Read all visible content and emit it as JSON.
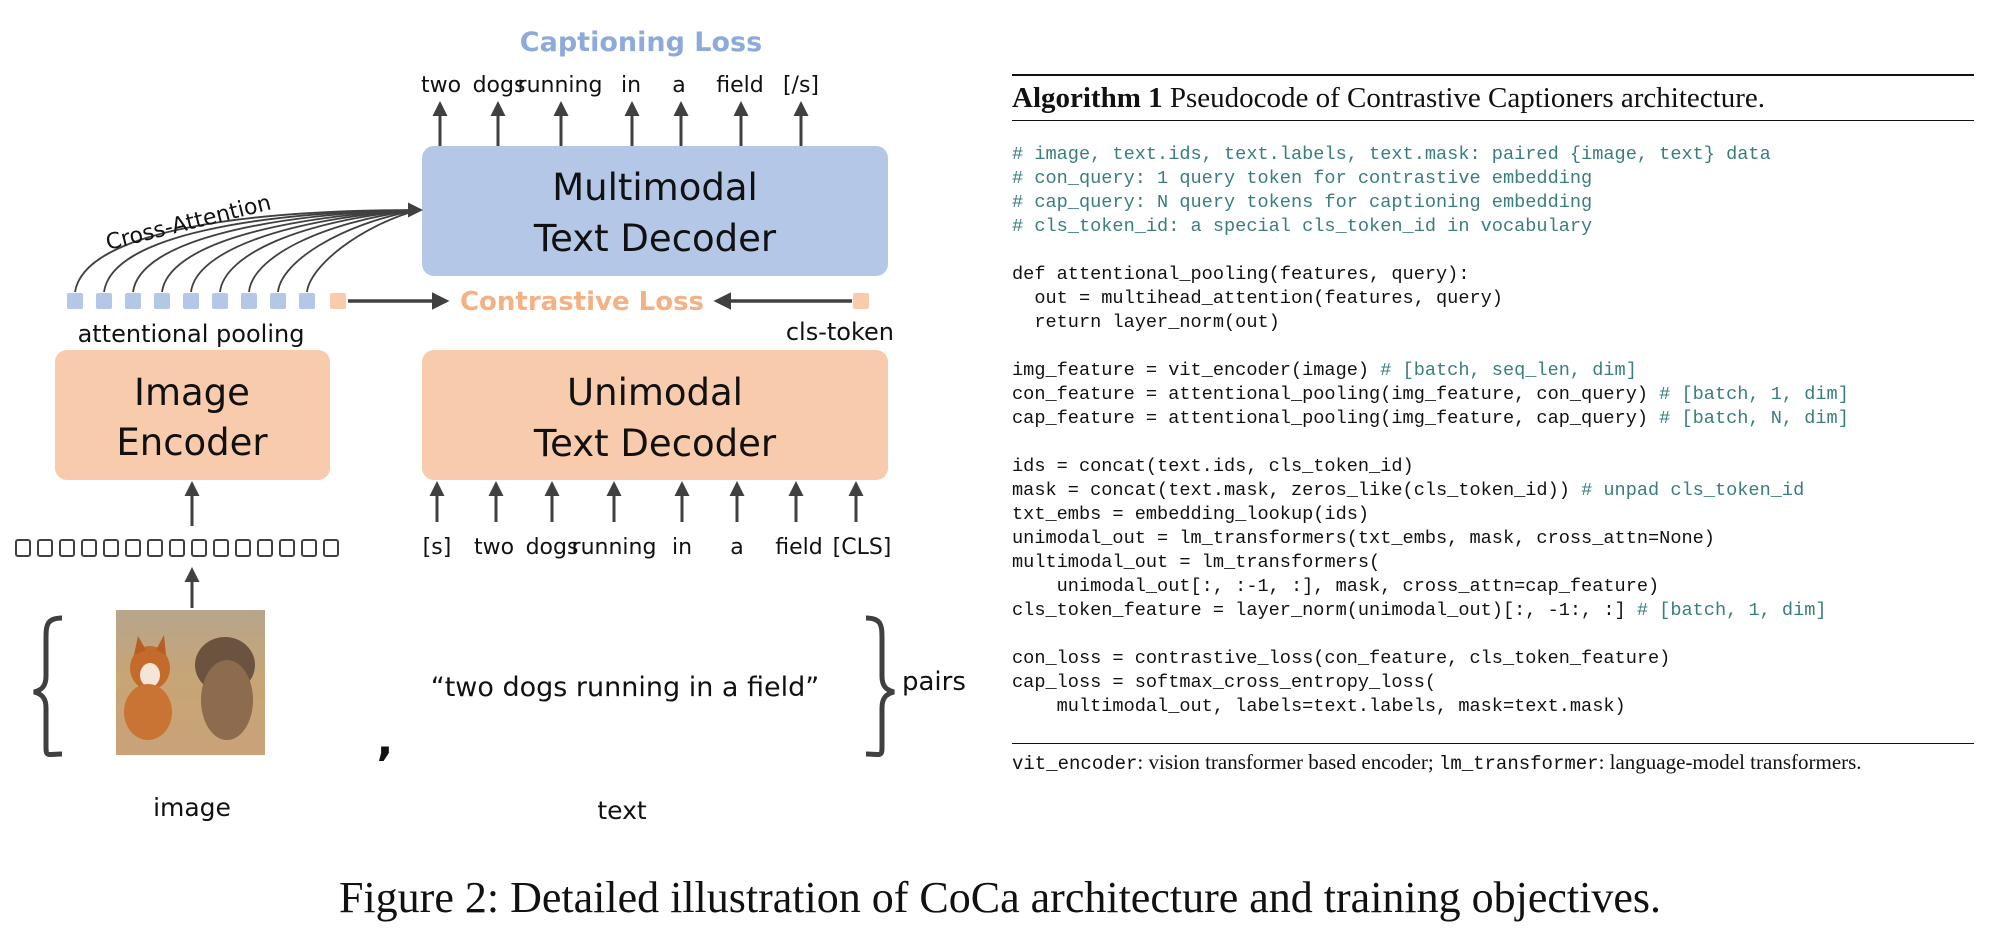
{
  "diagram": {
    "captioning_loss": "Captioning Loss",
    "output_tokens": [
      "two",
      "dogs",
      "running",
      "in",
      "a",
      "field",
      "[/s]"
    ],
    "multimodal_decoder": [
      "Multimodal",
      "Text Decoder"
    ],
    "cross_attention": "Cross-Attention",
    "contrastive_loss": "Contrastive Loss",
    "attentional_pooling": "attentional pooling",
    "cls_token": "cls-token",
    "image_encoder": [
      "Image",
      "Encoder"
    ],
    "unimodal_decoder": [
      "Unimodal",
      "Text Decoder"
    ],
    "input_tokens": [
      "[s]",
      "two",
      "dogs",
      "running",
      "in",
      "a",
      "field",
      "[CLS]"
    ],
    "text_pair": "“two dogs running in a field”",
    "comma": ",",
    "pairs": "pairs",
    "image_label": "image",
    "text_label": "text",
    "colors": {
      "blue_box": "#b4c7e7",
      "blue_text": "#8eaadb",
      "orange_box": "#f8cbad",
      "orange_text": "#f4b183",
      "arrow": "#404040"
    }
  },
  "algorithm": {
    "label": "Algorithm 1",
    "title": "Pseudocode of Contrastive Captioners architecture.",
    "code_lines": [
      {
        "code": "",
        "comment": "# image, text.ids, text.labels, text.mask: paired {image, text} data"
      },
      {
        "code": "",
        "comment": "# con_query: 1 query token for contrastive embedding"
      },
      {
        "code": "",
        "comment": "# cap_query: N query tokens for captioning embedding"
      },
      {
        "code": "",
        "comment": "# cls_token_id: a special cls_token_id in vocabulary"
      },
      {
        "code": "",
        "comment": ""
      },
      {
        "code": "def attentional_pooling(features, query):",
        "comment": ""
      },
      {
        "code": "  out = multihead_attention(features, query)",
        "comment": ""
      },
      {
        "code": "  return layer_norm(out)",
        "comment": ""
      },
      {
        "code": "",
        "comment": ""
      },
      {
        "code": "img_feature = vit_encoder(image) ",
        "comment": "# [batch, seq_len, dim]"
      },
      {
        "code": "con_feature = attentional_pooling(img_feature, con_query) ",
        "comment": "# [batch, 1, dim]"
      },
      {
        "code": "cap_feature = attentional_pooling(img_feature, cap_query) ",
        "comment": "# [batch, N, dim]"
      },
      {
        "code": "",
        "comment": ""
      },
      {
        "code": "ids = concat(text.ids, cls_token_id)",
        "comment": ""
      },
      {
        "code": "mask = concat(text.mask, zeros_like(cls_token_id)) ",
        "comment": "# unpad cls_token_id"
      },
      {
        "code": "txt_embs = embedding_lookup(ids)",
        "comment": ""
      },
      {
        "code": "unimodal_out = lm_transformers(txt_embs, mask, cross_attn=None)",
        "comment": ""
      },
      {
        "code": "multimodal_out = lm_transformers(",
        "comment": ""
      },
      {
        "code": "    unimodal_out[:, :-1, :], mask, cross_attn=cap_feature)",
        "comment": ""
      },
      {
        "code": "cls_token_feature = layer_norm(unimodal_out)[:, -1:, :] ",
        "comment": "# [batch, 1, dim]"
      },
      {
        "code": "",
        "comment": ""
      },
      {
        "code": "con_loss = contrastive_loss(con_feature, cls_token_feature)",
        "comment": ""
      },
      {
        "code": "cap_loss = softmax_cross_entropy_loss(",
        "comment": ""
      },
      {
        "code": "    multimodal_out, labels=text.labels, mask=text.mask)",
        "comment": ""
      }
    ],
    "footnote": {
      "t1": "vit_encoder",
      "t2": ": vision transformer based encoder; ",
      "t3": "lm_transformer",
      "t4": ": language-model transformers."
    }
  },
  "figure_caption": "Figure 2: Detailed illustration of CoCa architecture and training objectives."
}
